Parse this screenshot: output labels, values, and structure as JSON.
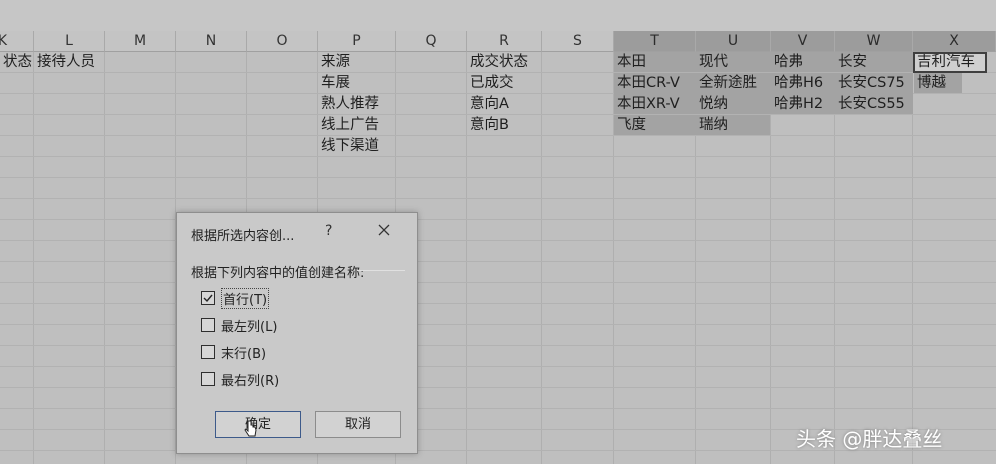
{
  "columns": [
    "K",
    "L",
    "M",
    "N",
    "O",
    "P",
    "Q",
    "R",
    "S",
    "T",
    "U",
    "V",
    "W",
    "X"
  ],
  "row1": {
    "K": "状态",
    "L": "接待人员"
  },
  "col_P": [
    "来源",
    "车展",
    "熟人推荐",
    "线上广告",
    "线下渠道"
  ],
  "col_R": [
    "成交状态",
    "已成交",
    "意向A",
    "意向B"
  ],
  "col_T": [
    "本田",
    "本田CR-V",
    "本田XR-V",
    "飞度"
  ],
  "col_U": [
    "现代",
    "全新途胜",
    "悦纳",
    "瑞纳"
  ],
  "col_V": [
    "哈弗",
    "哈弗H6",
    "哈弗H2"
  ],
  "col_W": [
    "长安",
    "长安CS75",
    "长安CS55"
  ],
  "col_X": [
    "吉利汽车",
    "博越"
  ],
  "dialog": {
    "title": "根据所选内容创...",
    "help": "?",
    "prompt": "根据下列内容中的值创建名称:",
    "options": [
      {
        "label": "首行(T)",
        "checked": true
      },
      {
        "label": "最左列(L)",
        "checked": false
      },
      {
        "label": "末行(B)",
        "checked": false
      },
      {
        "label": "最右列(R)",
        "checked": false
      }
    ],
    "ok": "确定",
    "cancel": "取消"
  },
  "watermark": "头条 @胖达叠丝"
}
